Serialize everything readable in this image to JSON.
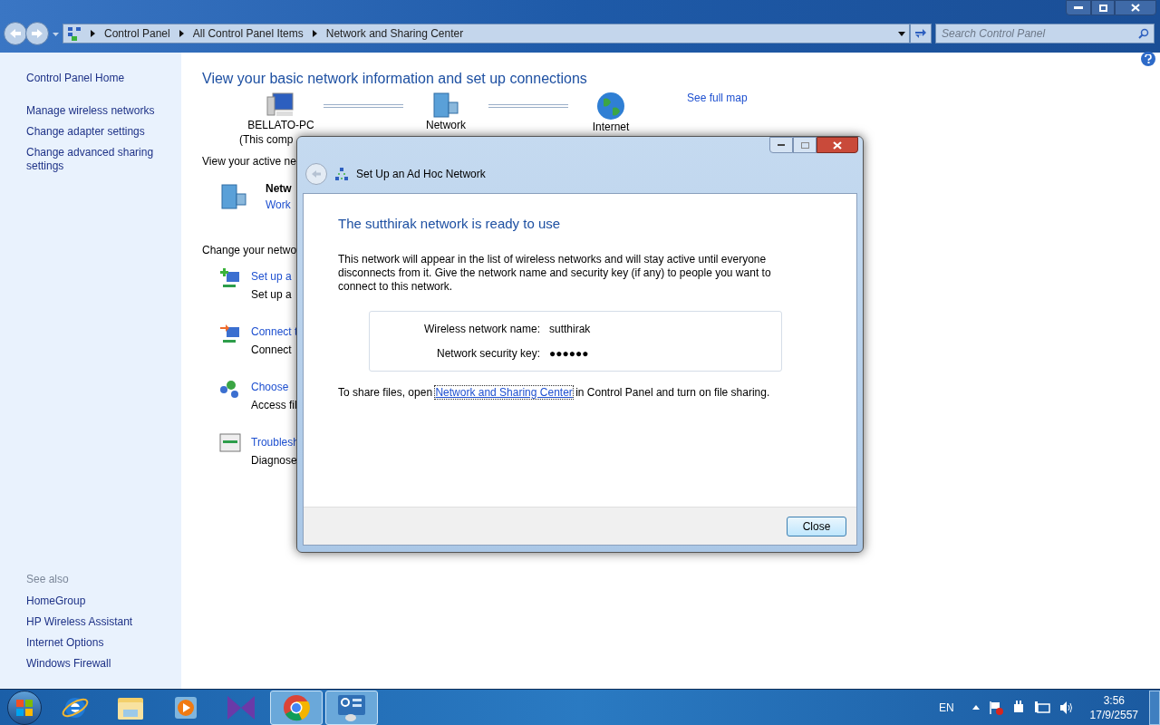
{
  "address_bar": {
    "crumbs": [
      "Control Panel",
      "All Control Panel Items",
      "Network and Sharing Center"
    ]
  },
  "search": {
    "placeholder": "Search Control Panel"
  },
  "sidebar": {
    "items": [
      "Control Panel Home",
      "Manage wireless networks",
      "Change adapter settings",
      "Change advanced sharing settings"
    ],
    "see_also_title": "See also",
    "see_also": [
      "HomeGroup",
      "HP Wireless Assistant",
      "Internet Options",
      "Windows Firewall"
    ]
  },
  "main": {
    "heading": "View your basic network information and set up connections",
    "map": {
      "nodes": [
        {
          "kind": "computer",
          "label": "BELLATO-PC",
          "sublabel": "(This comp"
        },
        {
          "kind": "network",
          "label": "Network"
        },
        {
          "kind": "internet",
          "label": "Internet"
        }
      ],
      "see_full_map": "See full map"
    },
    "active_title": "View your active ne",
    "active_network": {
      "name": "Netw",
      "type": "Work"
    },
    "change_title": "Change your netwo",
    "tasks": [
      {
        "kind": "setup",
        "link": "Set up a",
        "desc": "Set up a"
      },
      {
        "kind": "connect",
        "link": "Connect t",
        "desc": "Connect"
      },
      {
        "kind": "homegroup",
        "link": "Choose",
        "desc": "Access fil"
      },
      {
        "kind": "troubleshoot",
        "link": "Troublesh",
        "desc": "Diagnose"
      }
    ]
  },
  "dialog": {
    "title": "Set Up an Ad Hoc Network",
    "heading": "The sutthirak network is ready to use",
    "body": "This network will appear in the list of wireless networks and will stay active until everyone disconnects from it. Give the network name and security key (if any) to people you want to connect to this network.",
    "fields": [
      {
        "label": "Wireless network name:",
        "value": "sutthirak"
      },
      {
        "label": "Network security key:",
        "value": "●●●●●●"
      }
    ],
    "share_before": "To share files, open",
    "share_link": "Network and Sharing Center",
    "share_after": "in Control Panel and turn on file sharing.",
    "close_button": "Close"
  },
  "taskbar": {
    "apps": [
      {
        "kind": "ie",
        "open": false
      },
      {
        "kind": "explorer",
        "open": false
      },
      {
        "kind": "media",
        "open": false
      },
      {
        "kind": "vs",
        "open": false
      },
      {
        "kind": "chrome",
        "open": true
      },
      {
        "kind": "control",
        "open": true
      }
    ],
    "language": "EN",
    "time": "3:56",
    "date": "17/9/2557"
  }
}
